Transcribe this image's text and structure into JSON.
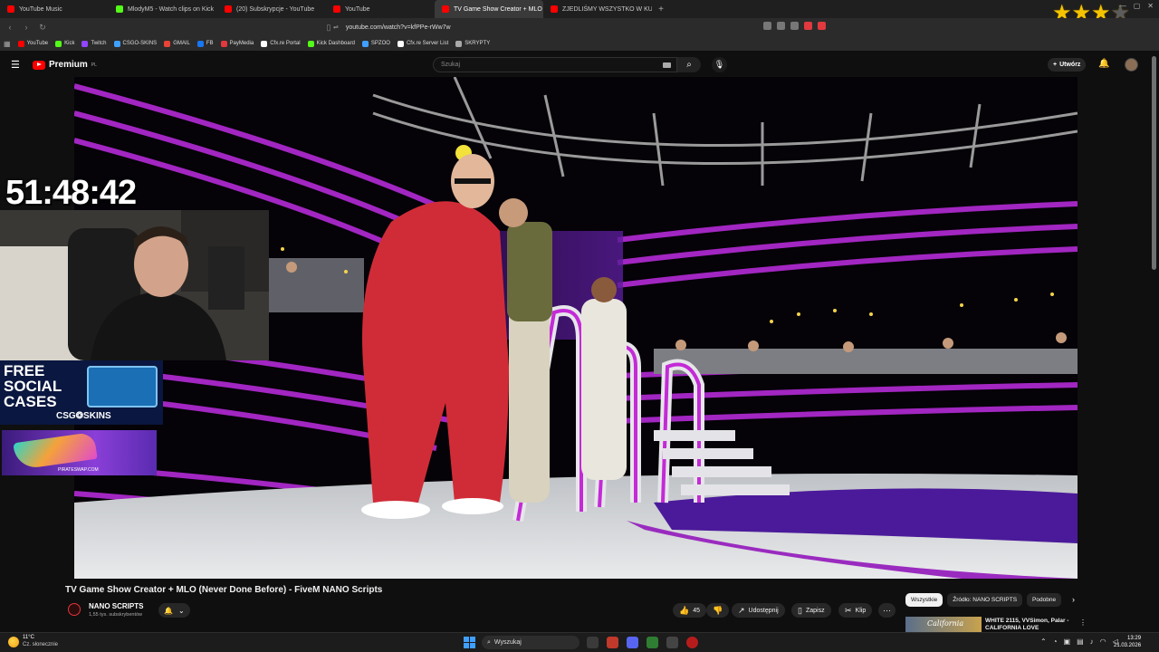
{
  "browser": {
    "tabs": [
      {
        "title": "YouTube Music",
        "color": "#ff0000",
        "active": false
      },
      {
        "title": "MlodyM5 - Watch clips on Kick",
        "color": "#53fc18",
        "active": false
      },
      {
        "title": "(20) Subskrypcje - YouTube",
        "color": "#ff0000",
        "active": false
      },
      {
        "title": "YouTube",
        "color": "#ff0000",
        "active": false
      },
      {
        "title": "TV Game Show Creator + MLO",
        "color": "#ff0000",
        "active": true
      },
      {
        "title": "ZJEDLIŚMY WSZYSTKO W KULINARN",
        "color": "#ff0000",
        "active": false
      }
    ],
    "close_glyph": "✕",
    "new_tab_glyph": "+",
    "url": "youtube.com/watch?v=kfPPe-rWw7w",
    "bookmarks": [
      {
        "label": "YouTube",
        "color": "#ff0000"
      },
      {
        "label": "Kick",
        "color": "#53fc18"
      },
      {
        "label": "Twitch",
        "color": "#9146ff"
      },
      {
        "label": "CSGO-SKINS",
        "color": "#3fa0ff"
      },
      {
        "label": "GMAIL",
        "color": "#ea4335"
      },
      {
        "label": "FB",
        "color": "#1877f2"
      },
      {
        "label": "PayMedia",
        "color": "#e0393e"
      },
      {
        "label": "Cfx.re Portal",
        "color": "#ffffff"
      },
      {
        "label": "Kick Dashboard",
        "color": "#53fc18"
      },
      {
        "label": "SPZOO",
        "color": "#3fa0ff"
      },
      {
        "label": "Cfx.re Server List",
        "color": "#ffffff"
      },
      {
        "label": "SKRYPTY",
        "color": "#aaaaaa"
      }
    ],
    "rating_stars": 3,
    "rating_total": 4
  },
  "youtube": {
    "logo": "Premium",
    "logo_region": "PL",
    "search_placeholder": "Szukaj",
    "create_label": "Utwórz",
    "video_title": "TV Game Show Creator + MLO (Never Done Before) - FiveM NANO Scripts",
    "channel_name": "NANO SCRIPTS",
    "channel_subs": "1,55 tys. subskrybentów",
    "likes": "45",
    "share_label": "Udostępnij",
    "save_label": "Zapisz",
    "clip_label": "Klip",
    "chips": [
      "Wszystkie",
      "Źródło: NANO SCRIPTS",
      "Podobne"
    ],
    "rec_title": "WHITE 2115, VVSimon, Palar - CALIFORNIA LOVE",
    "rec_thumb_text": "California"
  },
  "overlay": {
    "timer": "51:48:42",
    "promo_lines": [
      "FREE",
      "SOCIAL",
      "CASES"
    ],
    "promo_brand": "CSG❂SKINS",
    "promo2_brand": "PIRATESWAP.COM"
  },
  "taskbar": {
    "temp": "11°C",
    "weather": "Cz. słonecznie",
    "search_label": "Wyszukaj",
    "time": "13:29",
    "date": "21.03.2026"
  }
}
